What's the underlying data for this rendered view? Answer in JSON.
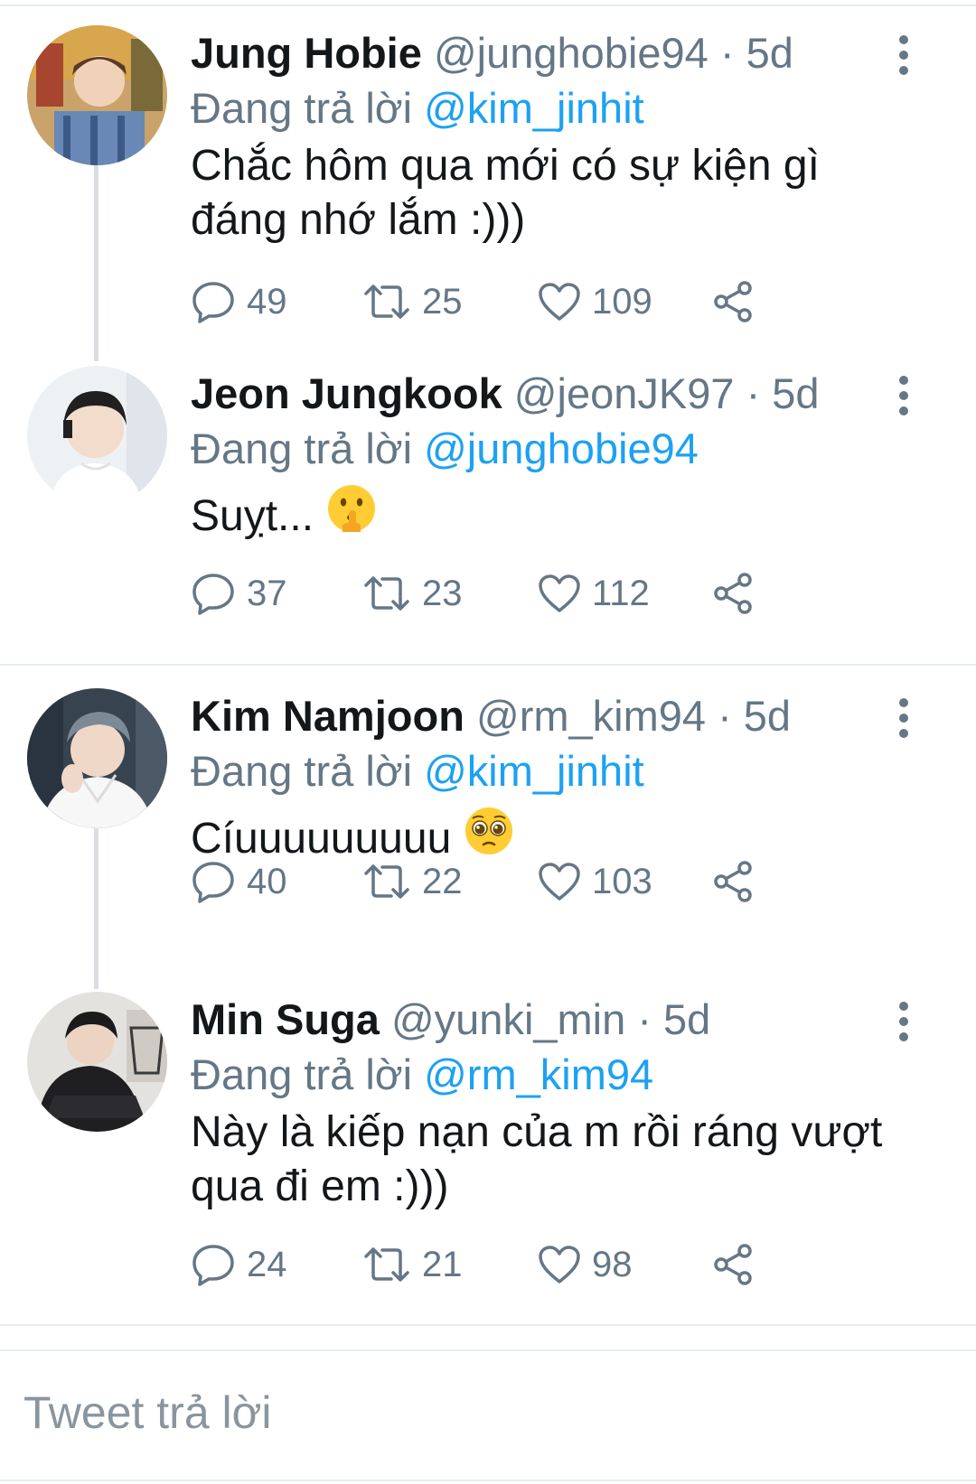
{
  "threads": [
    {
      "tweets": [
        {
          "display_name": "Jung Hobie",
          "handle": "@junghobie94",
          "separator": "·",
          "time": "5d",
          "replying_prefix": "Đang trả lời",
          "replying_to": "@kim_jinhit",
          "text": "Chắc hôm qua mới có sự kiện gì đáng nhớ lắm :)))",
          "avatar_icon": "avatar-photo-hobie",
          "counts": {
            "replies": "49",
            "retweets": "25",
            "likes": "109"
          }
        },
        {
          "display_name": "Jeon Jungkook",
          "handle": "@jeonJK97",
          "separator": "·",
          "time": "5d",
          "replying_prefix": "Đang trả lời",
          "replying_to": "@junghobie94",
          "text": "Suỵt...",
          "emoji": "shushing-face-emoji",
          "avatar_icon": "avatar-photo-jungkook",
          "counts": {
            "replies": "37",
            "retweets": "23",
            "likes": "112"
          }
        }
      ]
    },
    {
      "tweets": [
        {
          "display_name": "Kim Namjoon",
          "handle": "@rm_kim94",
          "separator": "·",
          "time": "5d",
          "replying_prefix": "Đang trả lời",
          "replying_to": "@kim_jinhit",
          "text": "Cíuuuuuuuuu",
          "emoji": "pleading-face-emoji",
          "avatar_icon": "avatar-photo-namjoon",
          "counts": {
            "replies": "40",
            "retweets": "22",
            "likes": "103"
          }
        },
        {
          "display_name": "Min Suga",
          "handle": "@yunki_min",
          "separator": "·",
          "time": "5d",
          "replying_prefix": "Đang trả lời",
          "replying_to": "@rm_kim94",
          "text": "Này là kiếp nạn của m rồi ráng vượt qua đi em :)))",
          "avatar_icon": "avatar-photo-suga",
          "counts": {
            "replies": "24",
            "retweets": "21",
            "likes": "98"
          }
        }
      ]
    }
  ],
  "compose": {
    "placeholder": "Tweet trả lời"
  },
  "colors": {
    "link": "#1da1f2",
    "secondary_text": "#657786",
    "primary_text": "#14171a",
    "divider": "#e6ecf0"
  }
}
